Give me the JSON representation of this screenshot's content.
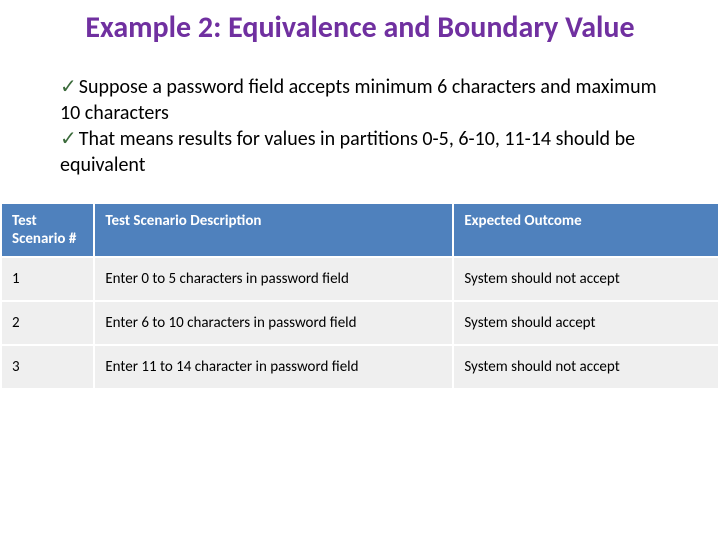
{
  "title": "Example 2: Equivalence and Boundary Value",
  "bullets": {
    "b1": "Suppose a password field accepts minimum 6 characters and maximum 10 characters",
    "b2": "That means results for values in partitions 0-5, 6-10, 11-14 should be equivalent"
  },
  "table": {
    "headers": {
      "h1": "Test Scenario #",
      "h2": "Test Scenario Description",
      "h3": "Expected Outcome"
    },
    "rows": [
      {
        "num": "1",
        "desc": "Enter 0 to 5 characters in password field",
        "out": "System should not accept"
      },
      {
        "num": "2",
        "desc": "Enter 6 to 10 characters in password field",
        "out": "System should accept"
      },
      {
        "num": "3",
        "desc": "Enter 11 to 14 character in password field",
        "out": "System should not accept"
      }
    ]
  }
}
